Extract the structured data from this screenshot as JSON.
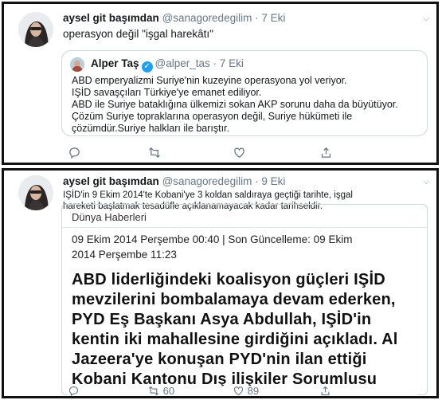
{
  "tweet1": {
    "author_name": "aysel git başımdan",
    "handle": "@sanagoredegilim",
    "separator": "·",
    "date": "7 Eki",
    "text": "operasyon değil \"işgal harekâtı\"",
    "quoted": {
      "author_name": "Alper Taş",
      "verified_mark": "✓",
      "handle": "@alper_tas",
      "separator": "·",
      "date": "7 Eki",
      "lines": [
        "ABD emperyalizmi Suriye'nin kuzeyine operasyona yol veriyor.",
        "IŞİD savaşçıları Türkiye'ye emanet ediliyor.",
        "ABD ile Suriye bataklığına ülkemizi sokan AKP sorunu daha da büyütüyor.",
        "Çözüm Suriye topraklarına operasyon değil, Suriye hükümeti ile",
        "çözümdür.Suriye halkları ile barıştır."
      ]
    }
  },
  "tweet2": {
    "author_name": "aysel git başımdan",
    "handle": "@sanagoredegilim",
    "separator": "·",
    "date": "9 Eki",
    "text_line1": "IŞİD'in 9 Ekim 2014'te Kobani'ye 3 koldan saldıraya geçtiği tarihte, işgal",
    "text_line2": "hareketi başlatmak tesadüfle açıklanamayacak kadar tarihseldir.",
    "card": {
      "source": "Dünya Haberleri",
      "date_line1": "09 Ekim 2014 Perşembe 00:40 | Son Güncelleme: 09 Ekim",
      "date_line2": "2014 Perşembe 11:23",
      "headline_lines": [
        "ABD liderliğindeki koalisyon güçleri IŞİD",
        "mevzilerini bombalamaya devam ederken,",
        "PYD Eş Başkanı Asya Abdullah, IŞİD'in",
        "kentin iki mahallesine girdiğini açıkladı. Al",
        "Jazeera'ye konuşan PYD'nin ilan ettiği",
        "Kobani Kantonu Dış ilişkiler Sorumlusu"
      ]
    },
    "retweet_count": "60",
    "like_count": "89"
  },
  "icons": {
    "reply": "reply-icon",
    "retweet": "retweet-icon",
    "like": "like-icon",
    "share": "share-icon",
    "more": "chevron-down-icon"
  },
  "colors": {
    "text": "#14171a",
    "secondary": "#657786",
    "verified": "#1da1f2",
    "border": "#ccd6dd",
    "panel_border": "#111111"
  }
}
